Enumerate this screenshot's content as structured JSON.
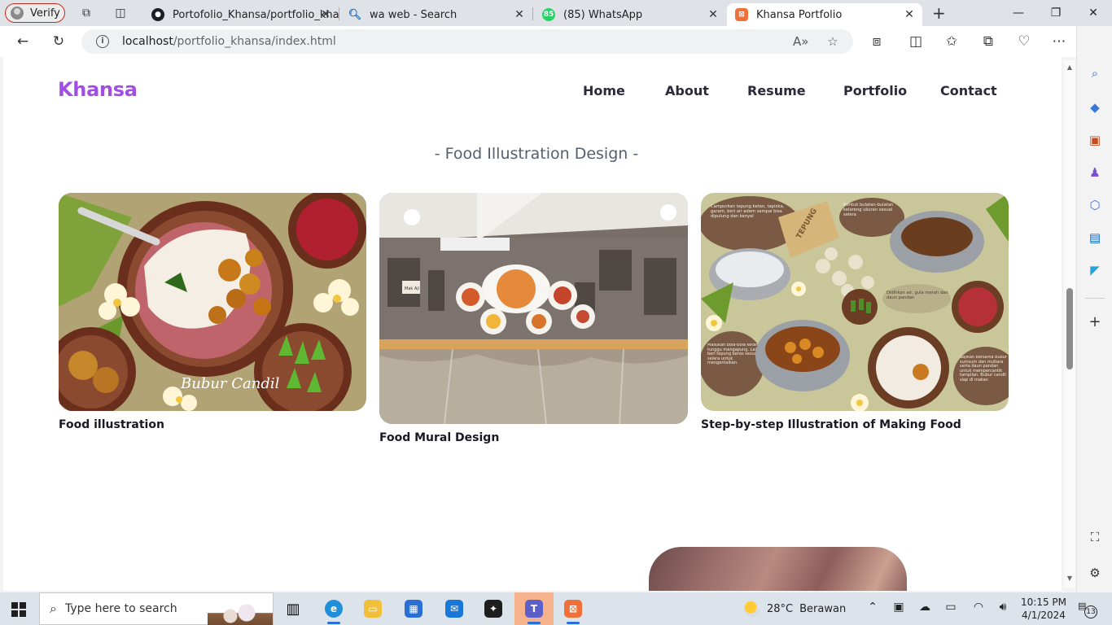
{
  "browser": {
    "profile_label": "Verify",
    "tabs": [
      {
        "label": "Portofolio_Khansa/portfolio_khan"
      },
      {
        "label": "wa web - Search"
      },
      {
        "label": "(85) WhatsApp"
      },
      {
        "label": "Khansa Portfolio"
      }
    ],
    "whatsapp_badge": "85",
    "new_tab_symbol": "+",
    "close_symbol": "✕",
    "window_controls": {
      "minimize": "—",
      "restore": "❐",
      "close": "✕"
    },
    "address": {
      "host": "localhost",
      "path": "/portfolio_khansa/index.html"
    }
  },
  "site": {
    "brand": "Khansa",
    "brand_color": "#a24ee3",
    "nav": [
      {
        "label": "Home"
      },
      {
        "label": "About"
      },
      {
        "label": "Resume"
      },
      {
        "label": "Portfolio"
      },
      {
        "label": "Contact"
      }
    ],
    "section_title": "- Food Illustration Design -",
    "cards": [
      {
        "caption": "Food illustration",
        "signature": "Bubur Candil"
      },
      {
        "caption": "Food Mural Design",
        "mural_sign": "Mak Ají"
      },
      {
        "caption": "Step-by-step Illustration of Making Food",
        "notes": [
          "Campurkan tepung ketan, tapioka, garam, beri air adem sampai bisa dipulung dan kenyal",
          "Bentuk bulatan-bulatan kelereng ukuran sesuai selera",
          "Didihkan air, gula merah dan daun pandan",
          "Masukan bola-bola ketan, tunggu mengapung. Lalu beri tepung beras sesuai selera untuk mengentalkan.",
          "Sajikan bersama bubur sumsum dan mutiara serta daun pandan untuk mempercantik tampilan. Bubur candil siap di makan"
        ],
        "bag_label": "TEPUNG"
      }
    ]
  },
  "taskbar": {
    "search_placeholder": "Type here to search",
    "weather": {
      "temp": "28°C",
      "condition": "Berawan"
    },
    "time": "10:15 PM",
    "date": "4/1/2024",
    "notifications": "13"
  }
}
